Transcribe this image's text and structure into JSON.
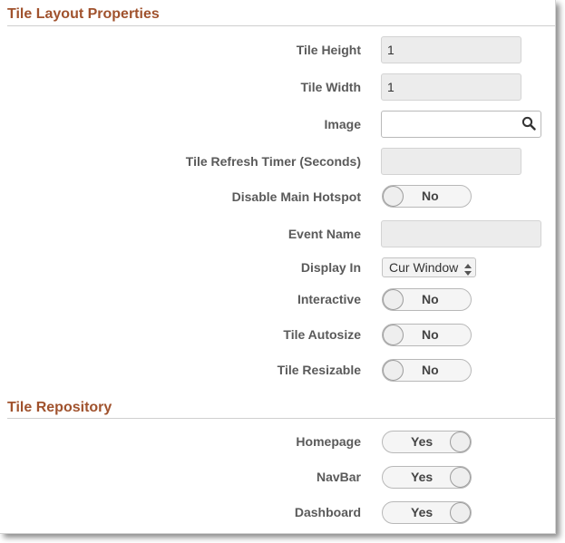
{
  "layout_section": {
    "title": "Tile Layout Properties",
    "tile_height": {
      "label": "Tile Height",
      "value": "1"
    },
    "tile_width": {
      "label": "Tile Width",
      "value": "1"
    },
    "image": {
      "label": "Image",
      "value": ""
    },
    "refresh_timer": {
      "label": "Tile Refresh Timer (Seconds)",
      "value": ""
    },
    "disable_main_hotspot": {
      "label": "Disable Main Hotspot",
      "state": "No"
    },
    "event_name": {
      "label": "Event Name",
      "value": ""
    },
    "display_in": {
      "label": "Display In",
      "selected": "Cur Window"
    },
    "interactive": {
      "label": "Interactive",
      "state": "No"
    },
    "tile_autosize": {
      "label": "Tile Autosize",
      "state": "No"
    },
    "tile_resizable": {
      "label": "Tile Resizable",
      "state": "No"
    }
  },
  "repository_section": {
    "title": "Tile Repository",
    "homepage": {
      "label": "Homepage",
      "state": "Yes"
    },
    "navbar": {
      "label": "NavBar",
      "state": "Yes"
    },
    "dashboard": {
      "label": "Dashboard",
      "state": "Yes"
    }
  },
  "colors": {
    "section_title": "#a0522d",
    "label": "#5a5a5a",
    "field_bg": "#ececec"
  },
  "icons": {
    "image_lookup": "search-icon",
    "display_in_select": "up-down-arrows-icon"
  }
}
